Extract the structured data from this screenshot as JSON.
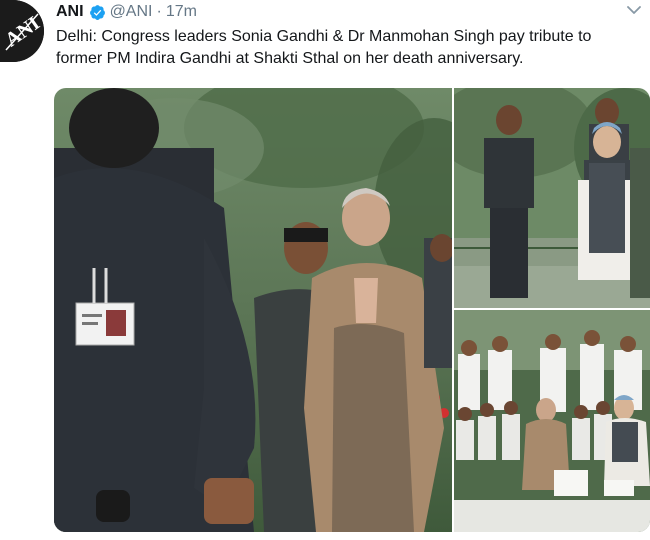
{
  "tweet": {
    "author_name": "ANI",
    "handle": "@ANI",
    "separator": "·",
    "time": "17m",
    "text_line1": "Delhi: Congress leaders Sonia Gandhi & Dr Manmohan Singh pay tribute to",
    "text_line2": "former PM Indira Gandhi at Shakti Sthal on her death anniversary.",
    "logo_text": "ANI"
  },
  "colors": {
    "verified_blue": "#1da1f2",
    "text_primary": "#14171a",
    "text_secondary": "#657786"
  },
  "icons": {
    "verified": "verified-badge-icon",
    "menu": "chevron-down-icon"
  },
  "media": {
    "photos": [
      "photo-sonia-gandhi-tribute",
      "photo-manmohan-singh-tribute",
      "photo-leaders-seated"
    ]
  }
}
